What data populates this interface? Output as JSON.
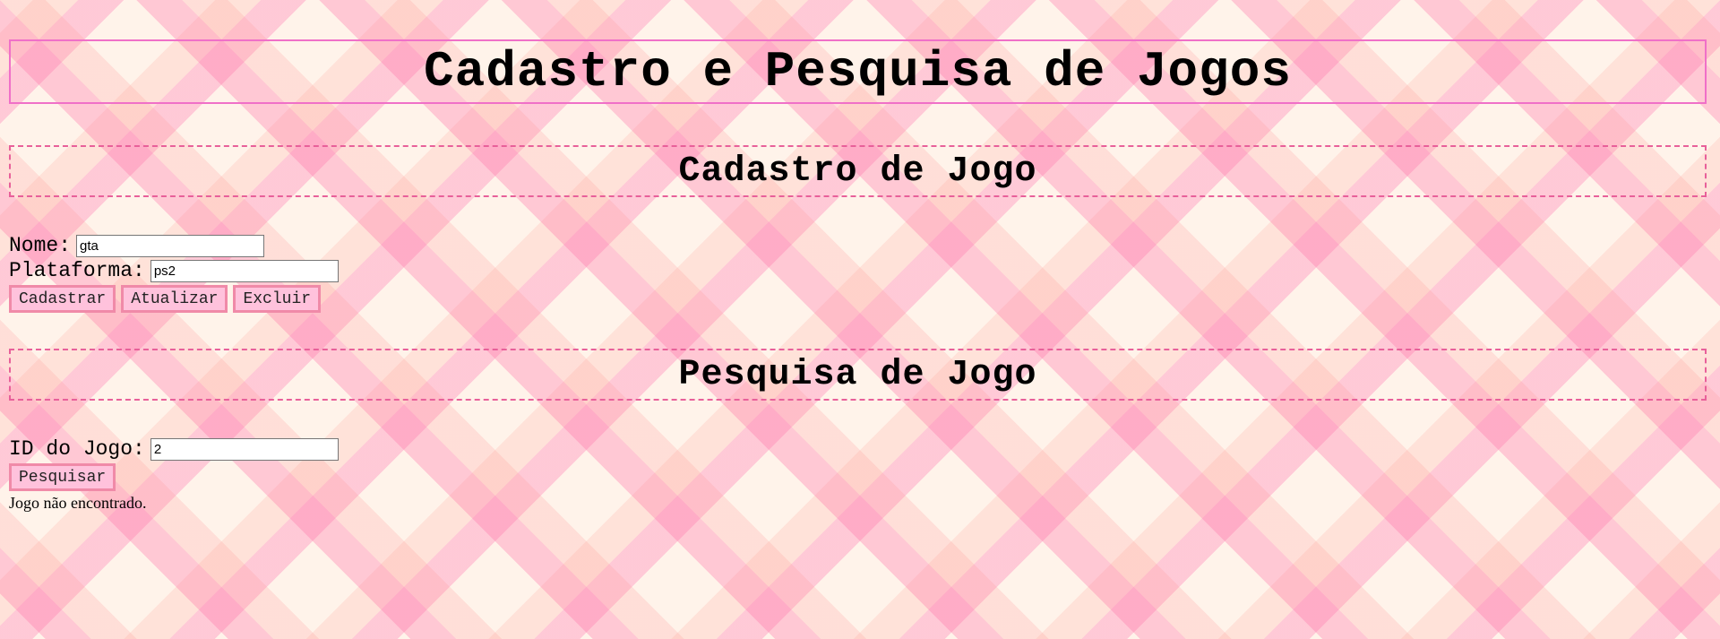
{
  "page": {
    "title": "Cadastro e Pesquisa de Jogos"
  },
  "cadastro": {
    "heading": "Cadastro de Jogo",
    "nome_label": "Nome:",
    "nome_value": "gta",
    "plataforma_label": "Plataforma:",
    "plataforma_value": "ps2",
    "buttons": {
      "cadastrar": "Cadastrar",
      "atualizar": "Atualizar",
      "excluir": "Excluir"
    }
  },
  "pesquisa": {
    "heading": "Pesquisa de Jogo",
    "id_label": "ID do Jogo:",
    "id_value": "2",
    "button": "Pesquisar",
    "result": "Jogo não encontrado."
  },
  "colors": {
    "header_border": "#f070c8",
    "section_border": "#e8609a",
    "button_bg": "#ffc2dc",
    "button_border": "#f08aa8"
  }
}
